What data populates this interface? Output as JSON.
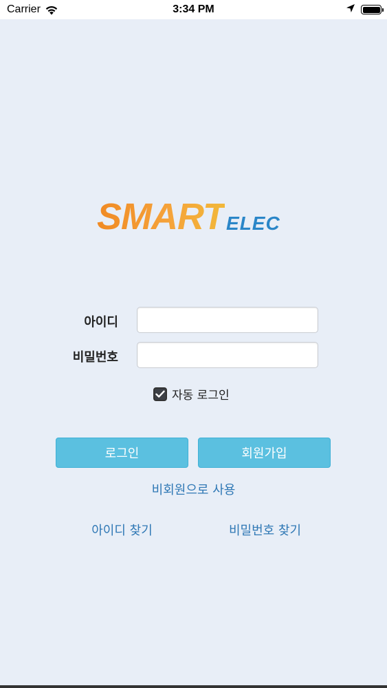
{
  "status_bar": {
    "carrier": "Carrier",
    "time": "3:34 PM",
    "icons": [
      "wifi-icon",
      "location-arrow-icon",
      "battery-icon"
    ]
  },
  "logo": {
    "main": "SMART",
    "sub": "ELEC",
    "colors": {
      "main": "#f29a2e",
      "sub": "#2a86c8"
    }
  },
  "form": {
    "id_label": "아이디",
    "id_value": "",
    "password_label": "비밀번호",
    "password_value": "",
    "auto_login_label": "자동 로그인",
    "auto_login_checked": true
  },
  "buttons": {
    "login": "로그인",
    "signup": "회원가입",
    "color": "#5bc0e0"
  },
  "links": {
    "guest": "비회원으로 사용",
    "find_id": "아이디 찾기",
    "find_password": "비밀번호 찾기",
    "color": "#2f78b5"
  }
}
